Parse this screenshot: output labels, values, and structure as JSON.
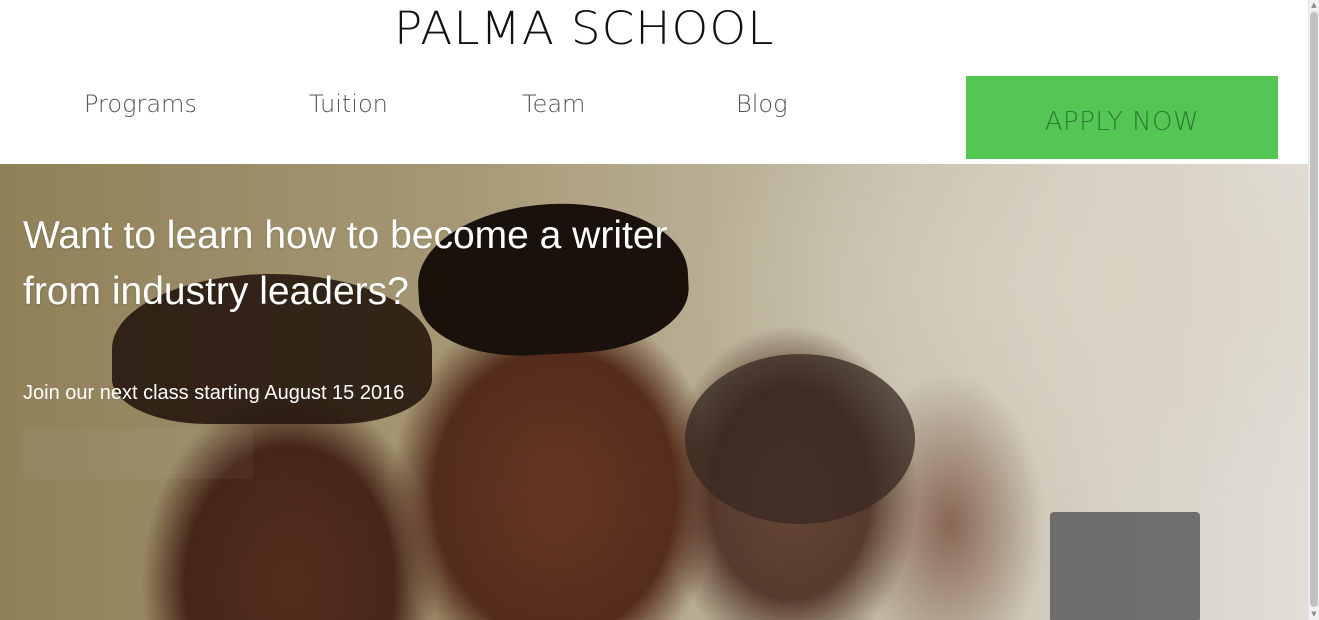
{
  "header": {
    "site_title": "PALMA SCHOOL",
    "nav": [
      {
        "label": "Programs"
      },
      {
        "label": "Tuition"
      },
      {
        "label": "Team"
      },
      {
        "label": "Blog"
      }
    ],
    "apply_button_label": "APPLY NOW"
  },
  "hero": {
    "heading": "Want to learn how to become a writer from industry leaders?",
    "subtext": "Join our next class starting August 15 2016"
  },
  "scrollbar": {
    "up_arrow": "▲",
    "down_arrow": "▼"
  },
  "colors": {
    "apply_button_bg": "#53c653",
    "apply_button_text": "#2f7a35",
    "nav_text": "#555555",
    "title_text": "#111111",
    "hero_text": "#ffffff"
  }
}
